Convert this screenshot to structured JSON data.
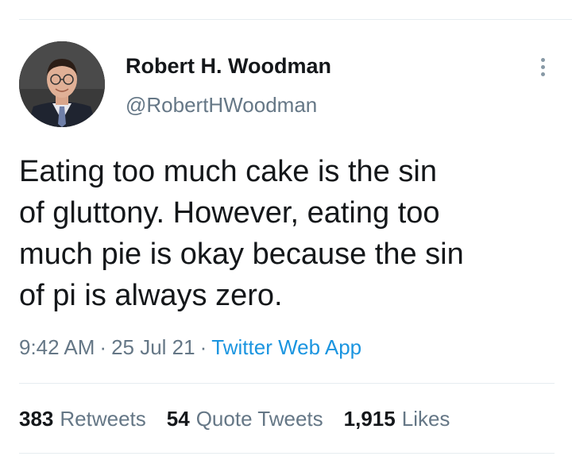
{
  "author": {
    "display_name": "Robert H. Woodman",
    "handle": "@RobertHWoodman",
    "avatar_icon": "profile-photo"
  },
  "tweet": {
    "lines": [
      "Eating too much cake is the sin",
      "of gluttony. However, eating too",
      "much pie is okay because the sin",
      "of pi is always zero."
    ]
  },
  "meta": {
    "time": "9:42 AM",
    "date": "25 Jul 21",
    "separator": "·",
    "source": "Twitter Web App"
  },
  "stats": {
    "retweets_count": "383",
    "retweets_label": "Retweets",
    "quotes_count": "54",
    "quotes_label": "Quote Tweets",
    "likes_count": "1,915",
    "likes_label": "Likes"
  },
  "colors": {
    "text": "#14171a",
    "secondary": "#657786",
    "link": "#1b95e0",
    "divider": "#e6ecf0"
  }
}
